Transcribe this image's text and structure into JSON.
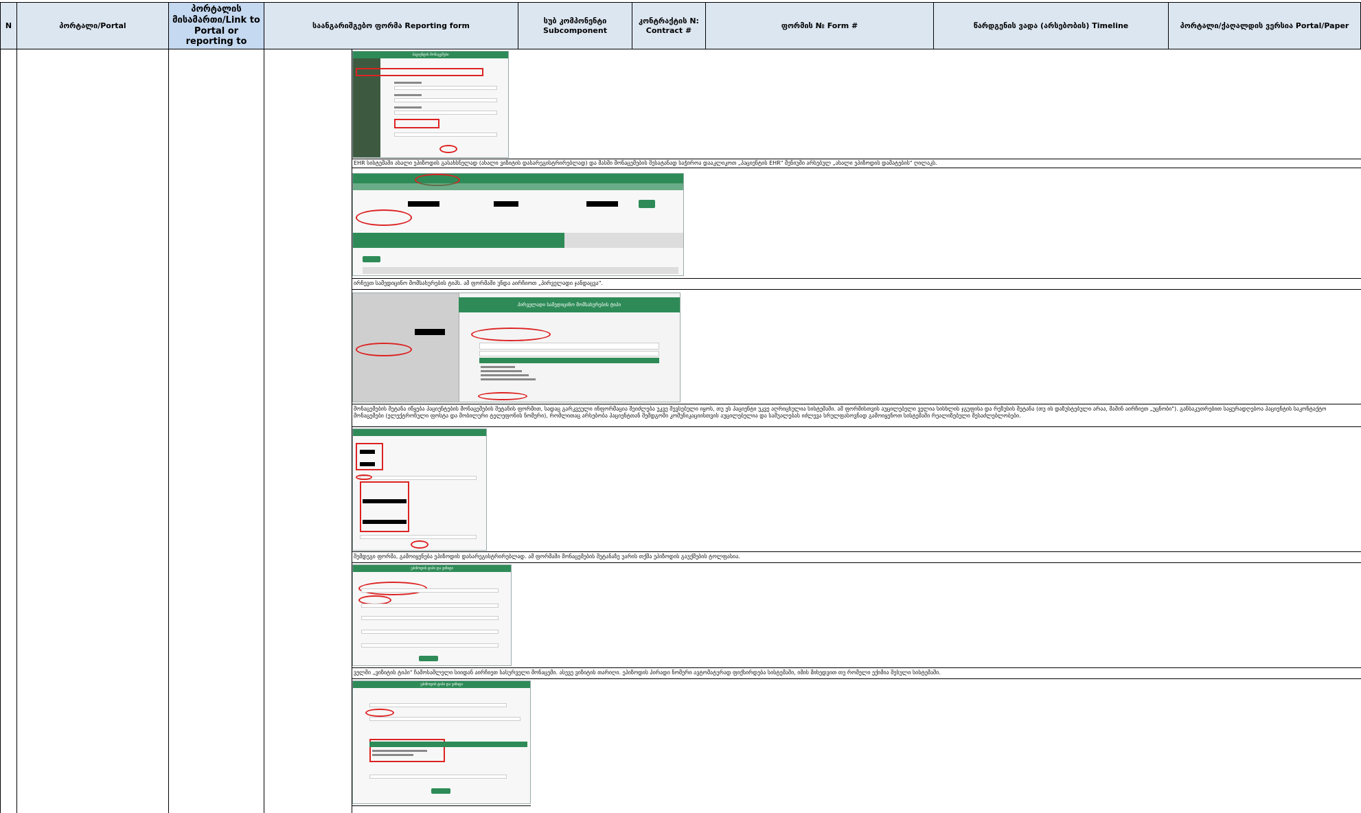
{
  "table": {
    "headers": {
      "n": "N",
      "portal": "პორტალი/Portal",
      "link": "პორტალის მისამართი/Link to Portal or reporting to",
      "form": "საანგარიშგებო ფორმა Reporting form",
      "subcomponent": "სუბ კომპონენტი Subcomponent",
      "contract": "კონტრაქტის N: Contract #",
      "form_no": "ფორმის № Form #",
      "timeline": "წარდგენის ვადა (არსებობის) Timeline",
      "portal_paper": "პორტალი/ქაღალდის ვერსია Portal/Paper"
    }
  },
  "captions": {
    "c1": "EHR სისტემაში ახალი ეპიზოდის გასახსნელად (ახალი ვიზიტის დასარეგისტრირებლად) და მასში მონაცემების შესატანად საჭიროა დააკლიკოთ „პაციენტის EHR\" მენიუში არსებულ „ახალი ეპიზოდის დამატების\" ღილაკს.",
    "c2": "ირჩევთ სამედიცინო მომსახურების ტიპს. ამ ფორმაში უნდა აირჩიოთ „პირველადი ჯანდაცვა\".",
    "c3": "მონაცემების შეტანა იწყება პაციენტების მონაცემების შეტანის ფორმით, სადაც გარკვეული ინფორმაცია შეიძლება უკვე შევსებული იყოს, თუ ეს პაციენტი უკვე აღრიცხულია სისტემაში. ამ ფორმისთვის აუცილებელი ველია სისხლის ჯგუფისა და რეზუსის შეტანა (თუ ის დაზუსტებული არაა, მაშინ აირჩიეთ „უცნობი\"). განსაკუთრებით საყურადღებოა პაციენტის საკონტაქტო მონაცემები (ელექტრონული ფოსტა და მობილური ტელეფონის ნომერი), რომლითაც არსებობა პაციენტთან შემდგომი კომუნიკაციისთვის აუცილებელია და საშუალებას იძლევა სრულფასოვნად გამოიყენოთ სისტემაში რეალიზებული შესაძლებლობები.",
    "c4": "შემდეგი ფორმა, გამოიყენება ეპიზოდის დასარეგისტრირებლად. ამ ფორმაში მონაცემების შეტანაზე უარის თქმა ეპიზოდის გაუქმების ტოლფასია.",
    "c5": "ველში „ვიზიტის ტიპი\" ჩამოსაშლელი სიიდან აირჩიეთ სასურველი მონაცემი. ასევე ვიზიტის თარიღი. ეპიზოდის პირადი ნომერი ავტომატურად ფიქსირდება სისტემაში, იმის მიხედვით თუ რომელი ექიმია შესული სისტემაში."
  },
  "screens": {
    "s1_title": "პაციენტის მონაცემები",
    "s2_tab": "პაციენტის EHR",
    "s3_modal": "პირველადი სამედიცინო მომსახურების ტიპი",
    "s3_dropdown_label": "სამედიცინო მომსახურების ტიპი *",
    "s5_title": "ეპიზოდის ტიპი და ვიზიტი",
    "s6_title": "ეპიზოდის ტიპი და ვიზიტი"
  },
  "colors": {
    "header_fill": "#dce6f1",
    "header_fill_dark": "#c5d9f1",
    "ehr_green": "#2e8b57",
    "annotation_red": "#d22222"
  }
}
